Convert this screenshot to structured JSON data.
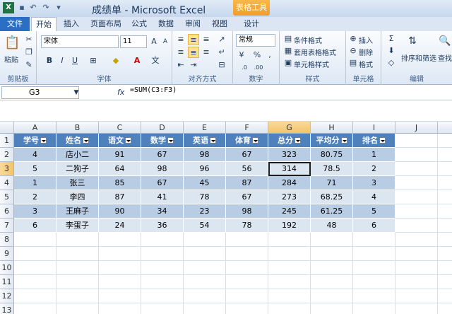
{
  "window": {
    "title": "成绩单 - Microsoft Excel",
    "context_tab": "表格工具"
  },
  "tabs": [
    "文件",
    "开始",
    "插入",
    "页面布局",
    "公式",
    "数据",
    "审阅",
    "视图",
    "设计"
  ],
  "ribbon": {
    "clipboard": {
      "paste": "粘贴",
      "label": "剪贴板"
    },
    "font": {
      "name": "宋体",
      "size": "11",
      "label": "字体"
    },
    "alignment": {
      "label": "对齐方式"
    },
    "number": {
      "format": "常规",
      "label": "数字"
    },
    "styles": {
      "conditional": "条件格式",
      "table_format": "套用表格格式",
      "cell_styles": "单元格样式",
      "label": "样式"
    },
    "cells": {
      "insert": "插入",
      "delete": "删除",
      "format": "格式",
      "label": "单元格"
    },
    "editing": {
      "sort_filter": "排序和筛选",
      "find": "查找",
      "label": "编辑"
    }
  },
  "formula_bar": {
    "name_box": "G3",
    "fx": "fx",
    "formula": "=SUM(C3:F3)"
  },
  "columns": [
    "A",
    "B",
    "C",
    "D",
    "E",
    "F",
    "G",
    "H",
    "I",
    "J",
    "K"
  ],
  "rows": [
    "1",
    "2",
    "3",
    "4",
    "5",
    "6",
    "7",
    "8",
    "9",
    "10",
    "11",
    "12",
    "13"
  ],
  "table": {
    "headers": [
      "学号",
      "姓名",
      "语文",
      "数学",
      "英语",
      "体育",
      "总分",
      "平均分",
      "排名"
    ],
    "rows": [
      [
        "4",
        "店小二",
        "91",
        "67",
        "98",
        "67",
        "323",
        "80.75",
        "1"
      ],
      [
        "5",
        "二狗子",
        "64",
        "98",
        "96",
        "56",
        "314",
        "78.5",
        "2"
      ],
      [
        "1",
        "张三",
        "85",
        "67",
        "45",
        "87",
        "284",
        "71",
        "3"
      ],
      [
        "2",
        "李四",
        "87",
        "41",
        "78",
        "67",
        "273",
        "68.25",
        "4"
      ],
      [
        "3",
        "王麻子",
        "90",
        "34",
        "23",
        "98",
        "245",
        "61.25",
        "5"
      ],
      [
        "6",
        "李蛋子",
        "24",
        "36",
        "54",
        "78",
        "192",
        "48",
        "6"
      ]
    ]
  },
  "colors": {
    "header": "#4f81bd",
    "band": "#b8cce4",
    "plain": "#dce6f1"
  }
}
